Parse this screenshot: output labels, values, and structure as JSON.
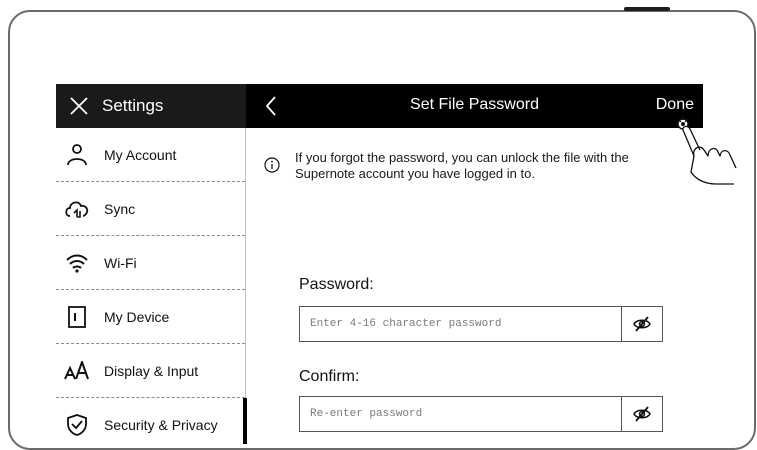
{
  "settings_panel": {
    "title": "Settings",
    "items": [
      {
        "label": "My Account",
        "icon": "user-icon"
      },
      {
        "label": "Sync",
        "icon": "cloud-sync-icon"
      },
      {
        "label": "Wi-Fi",
        "icon": "wifi-icon"
      },
      {
        "label": "My Device",
        "icon": "device-icon"
      },
      {
        "label": "Display & Input",
        "icon": "text-size-icon"
      },
      {
        "label": "Security & Privacy",
        "icon": "shield-check-icon",
        "active": true
      }
    ]
  },
  "header": {
    "title": "Set File Password",
    "done_label": "Done"
  },
  "info": {
    "text": "If you forgot the password, you can unlock the file with the Supernote account you have logged in to."
  },
  "password": {
    "label": "Password:",
    "placeholder": "Enter 4-16 character password",
    "value": ""
  },
  "confirm": {
    "label": "Confirm:",
    "placeholder": "Re-enter password",
    "value": ""
  },
  "colors": {
    "header_bg": "#000000",
    "text": "#111111",
    "device_outline": "#6a6a6a"
  }
}
